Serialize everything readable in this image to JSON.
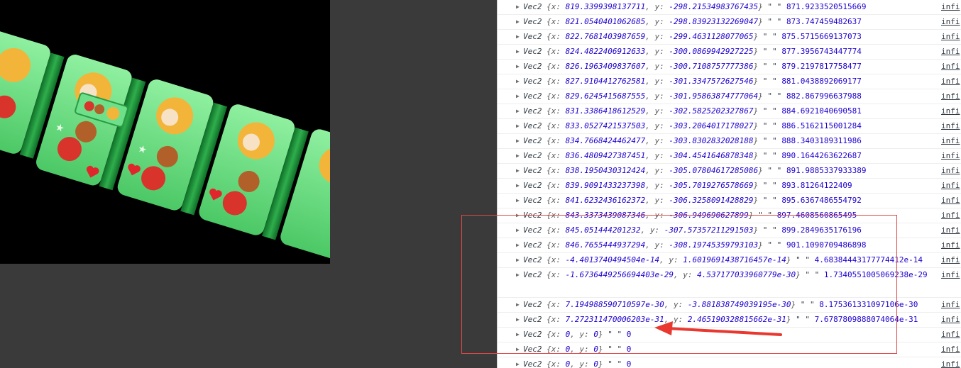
{
  "console": {
    "source_link": "infi",
    "rows": [
      {
        "x": "819.3399398137711",
        "y": "-298.21534983767435",
        "v": "871.9233520515669",
        "tall": false
      },
      {
        "x": "821.0540401062685",
        "y": "-298.83923132269047",
        "v": "873.747459482637",
        "tall": false
      },
      {
        "x": "822.7681403987659",
        "y": "-299.4631128077065",
        "v": "875.5715669137073",
        "tall": false
      },
      {
        "x": "824.4822406912633",
        "y": "-300.0869942927225",
        "v": "877.3956743447774",
        "tall": false
      },
      {
        "x": "826.1963409837607",
        "y": "-300.7108757777386",
        "v": "879.2197817758477",
        "tall": false
      },
      {
        "x": "827.9104412762581",
        "y": "-301.3347572627546",
        "v": "881.0438892069177",
        "tall": false
      },
      {
        "x": "829.6245415687555",
        "y": "-301.95863874777064",
        "v": "882.867996637988",
        "tall": false
      },
      {
        "x": "831.3386418612529",
        "y": "-302.5825202327867",
        "v": "884.6921040690581",
        "tall": false
      },
      {
        "x": "833.0527421537503",
        "y": "-303.2064017178027",
        "v": "886.5162115001284",
        "tall": false
      },
      {
        "x": "834.7668424462477",
        "y": "-303.8302832028188",
        "v": "888.3403189311986",
        "tall": false
      },
      {
        "x": "836.4809427387451",
        "y": "-304.4541646878348",
        "v": "890.1644263622687",
        "tall": false
      },
      {
        "x": "838.1950430312424",
        "y": "-305.07804617285086",
        "v": "891.9885337933389",
        "tall": false
      },
      {
        "x": "839.9091433237398",
        "y": "-305.7019276578669",
        "v": "893.81264122409",
        "tall": false
      },
      {
        "x": "841.6232436162372",
        "y": "-306.3258091428829",
        "v": "895.6367486554792",
        "tall": false
      },
      {
        "x": "843.3373439087346",
        "y": "-306.949690627899",
        "v": "897.4608560865495",
        "tall": false
      },
      {
        "x": "845.051444201232",
        "y": "-307.57357211291503",
        "v": "899.2849635176196",
        "tall": false
      },
      {
        "x": "846.7655444937294",
        "y": "-308.19745359793103",
        "v": "901.1090709486898",
        "tall": false
      },
      {
        "x": "-4.4013740494504e-14",
        "y": "1.6019691438716457e-14",
        "v": "4.68384443177774412e-14",
        "tall": false
      },
      {
        "x": "-1.6736449256694403e-29",
        "y": "4.537177033960779e-30",
        "v": "1.7340551005069238e-29",
        "tall": true
      },
      {
        "x": "7.194988590710597e-30",
        "y": "-3.881838749039195e-30",
        "v": "8.175361331097106e-30",
        "tall": false
      },
      {
        "x": "7.272311470006203e-31",
        "y": "2.465190328815662e-31",
        "v": "7.6787809888074064e-31",
        "tall": false
      },
      {
        "x": "0",
        "y": "0",
        "v": "0",
        "tall": false
      },
      {
        "x": "0",
        "y": "0",
        "v": "0",
        "tall": false
      },
      {
        "x": "0",
        "y": "0",
        "v": "0",
        "tall": false
      }
    ]
  },
  "tokens": {
    "class_name": "Vec2",
    "open": "{",
    "x_key": "x: ",
    "y_key": "y: ",
    "sep": ", ",
    "close": "}",
    "quote_pair": " \"   \" "
  },
  "colors": {
    "highlight": "#e04848",
    "card_green": "#5fd67a",
    "card_dark": "#1e8f3a"
  }
}
